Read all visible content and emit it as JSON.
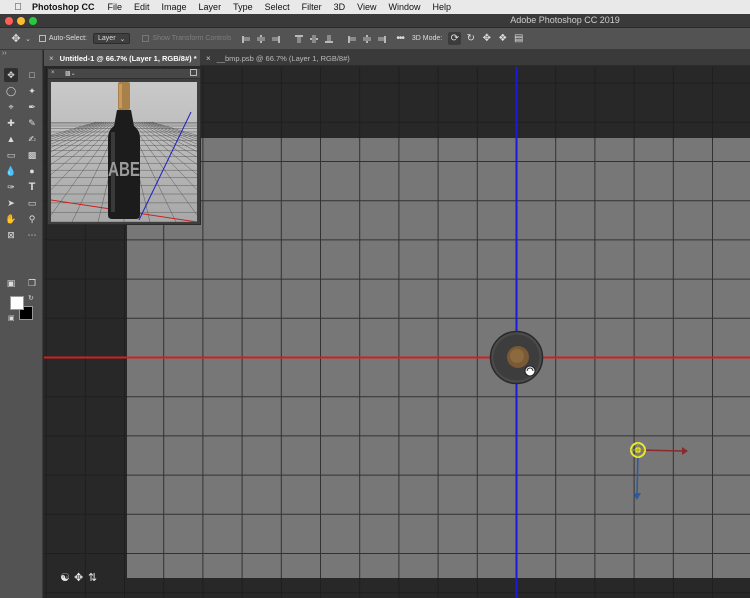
{
  "menubar": {
    "app_name": "Photoshop CC",
    "items": [
      "File",
      "Edit",
      "Image",
      "Layer",
      "Type",
      "Select",
      "Filter",
      "3D",
      "View",
      "Window",
      "Help"
    ]
  },
  "window": {
    "title": "Adobe Photoshop CC 2019"
  },
  "options": {
    "auto_select_label": "Auto-Select:",
    "auto_select_checked": false,
    "layer_select_value": "Layer",
    "show_transform_controls_label": "Show Transform Controls",
    "mode_3d_label": "3D Mode:",
    "more_label": "•••"
  },
  "tabs": [
    {
      "label": "Untitled-1 @ 66.7% (Layer 1, RGB/8#) *",
      "active": true
    },
    {
      "label": "__bmp.psb @ 66.7% (Layer 1, RGB/8#)",
      "active": false
    }
  ],
  "camera_panel": {
    "bottle_label": "ABE"
  },
  "colors": {
    "foreground": "#ffffff",
    "background": "#000000",
    "x_axis": "#d61e1e",
    "y_axis": "#1a1adc",
    "gizmo_center": "#e8e835"
  },
  "icons": {
    "tools": [
      "move-icon",
      "marquee-icon",
      "lasso-icon",
      "magic-wand-icon",
      "crop-icon",
      "eyedropper-icon",
      "healing-brush-icon",
      "brush-icon",
      "clone-stamp-icon",
      "history-brush-icon",
      "eraser-icon",
      "gradient-icon",
      "blur-icon",
      "dodge-icon",
      "pen-icon",
      "type-icon",
      "path-selection-icon",
      "rectangle-icon",
      "hand-icon",
      "zoom-icon",
      "frame-icon",
      "more-tools-icon"
    ]
  }
}
